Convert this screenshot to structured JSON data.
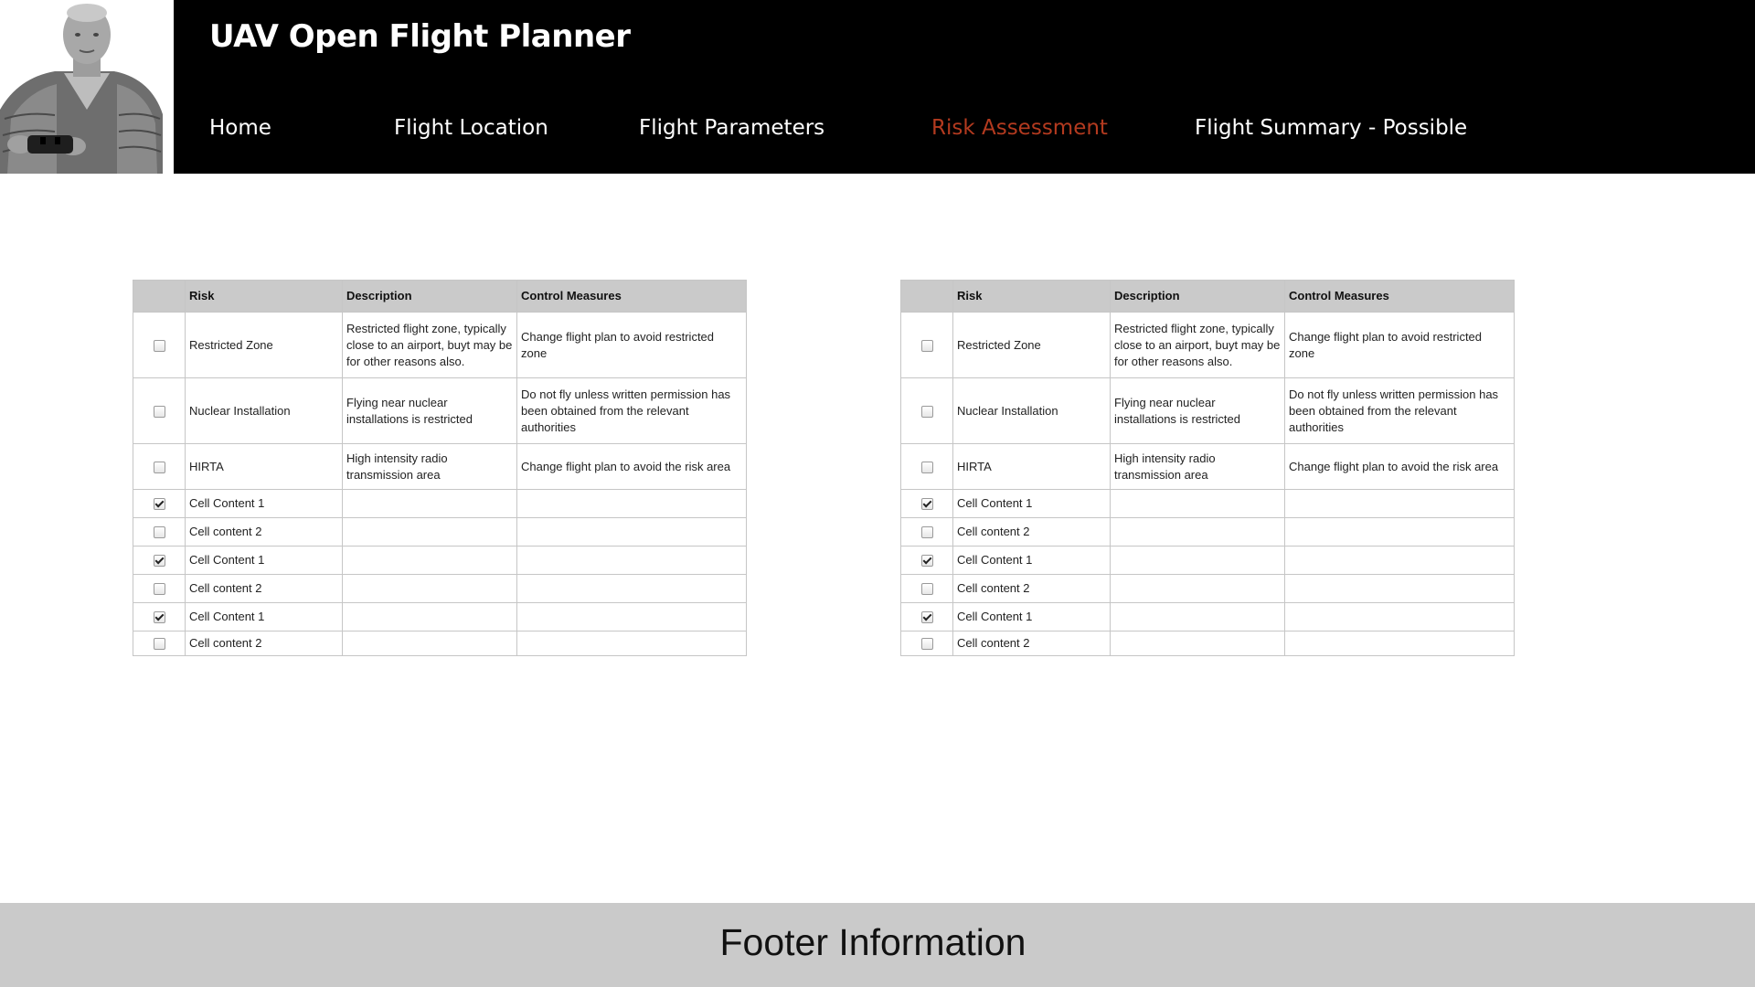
{
  "header": {
    "title": "UAV Open Flight Planner",
    "nav": [
      {
        "label": "Home",
        "active": false
      },
      {
        "label": "Flight Location",
        "active": false
      },
      {
        "label": "Flight Parameters",
        "active": false
      },
      {
        "label": "Risk Assessment",
        "active": true
      },
      {
        "label": "Flight Summary - Possible",
        "active": false
      }
    ],
    "active_color": "#b33a1f"
  },
  "tables": [
    {
      "headers": {
        "select": "",
        "risk": "Risk",
        "description": "Description",
        "control": "Control Measures"
      },
      "rows": [
        {
          "checked": false,
          "risk": "Restricted Zone",
          "description": "Restricted flight zone, typically close to an airport, buyt may be for other reasons also.",
          "control": "Change flight plan to avoid restricted zone"
        },
        {
          "checked": false,
          "risk": "Nuclear Installation",
          "description": "Flying near nuclear installations is restricted",
          "control": "Do not fly unless written permission has been obtained from the relevant authorities"
        },
        {
          "checked": false,
          "risk": "HIRTA",
          "description": "High intensity radio transmission area",
          "control": "Change flight plan to avoid the risk area"
        },
        {
          "checked": true,
          "risk": "Cell Content 1",
          "description": "",
          "control": ""
        },
        {
          "checked": false,
          "risk": "Cell content 2",
          "description": "",
          "control": ""
        },
        {
          "checked": true,
          "risk": "Cell Content 1",
          "description": "",
          "control": ""
        },
        {
          "checked": false,
          "risk": "Cell content 2",
          "description": "",
          "control": ""
        },
        {
          "checked": true,
          "risk": "Cell Content 1",
          "description": "",
          "control": ""
        },
        {
          "checked": false,
          "risk": "Cell content 2",
          "description": "",
          "control": ""
        }
      ]
    },
    {
      "headers": {
        "select": "",
        "risk": "Risk",
        "description": "Description",
        "control": "Control Measures"
      },
      "rows": [
        {
          "checked": false,
          "risk": "Restricted Zone",
          "description": "Restricted flight zone, typically close to an airport, buyt may be for other reasons also.",
          "control": "Change flight plan to avoid restricted zone"
        },
        {
          "checked": false,
          "risk": "Nuclear Installation",
          "description": "Flying near nuclear installations is restricted",
          "control": "Do not fly unless written permission has been obtained from the relevant authorities"
        },
        {
          "checked": false,
          "risk": "HIRTA",
          "description": "High intensity radio transmission area",
          "control": "Change flight plan to avoid the risk area"
        },
        {
          "checked": true,
          "risk": "Cell Content 1",
          "description": "",
          "control": ""
        },
        {
          "checked": false,
          "risk": "Cell content 2",
          "description": "",
          "control": ""
        },
        {
          "checked": true,
          "risk": "Cell Content 1",
          "description": "",
          "control": ""
        },
        {
          "checked": false,
          "risk": "Cell content 2",
          "description": "",
          "control": ""
        },
        {
          "checked": true,
          "risk": "Cell Content 1",
          "description": "",
          "control": ""
        },
        {
          "checked": false,
          "risk": "Cell content 2",
          "description": "",
          "control": ""
        }
      ]
    }
  ],
  "footer": {
    "text": "Footer Information"
  }
}
